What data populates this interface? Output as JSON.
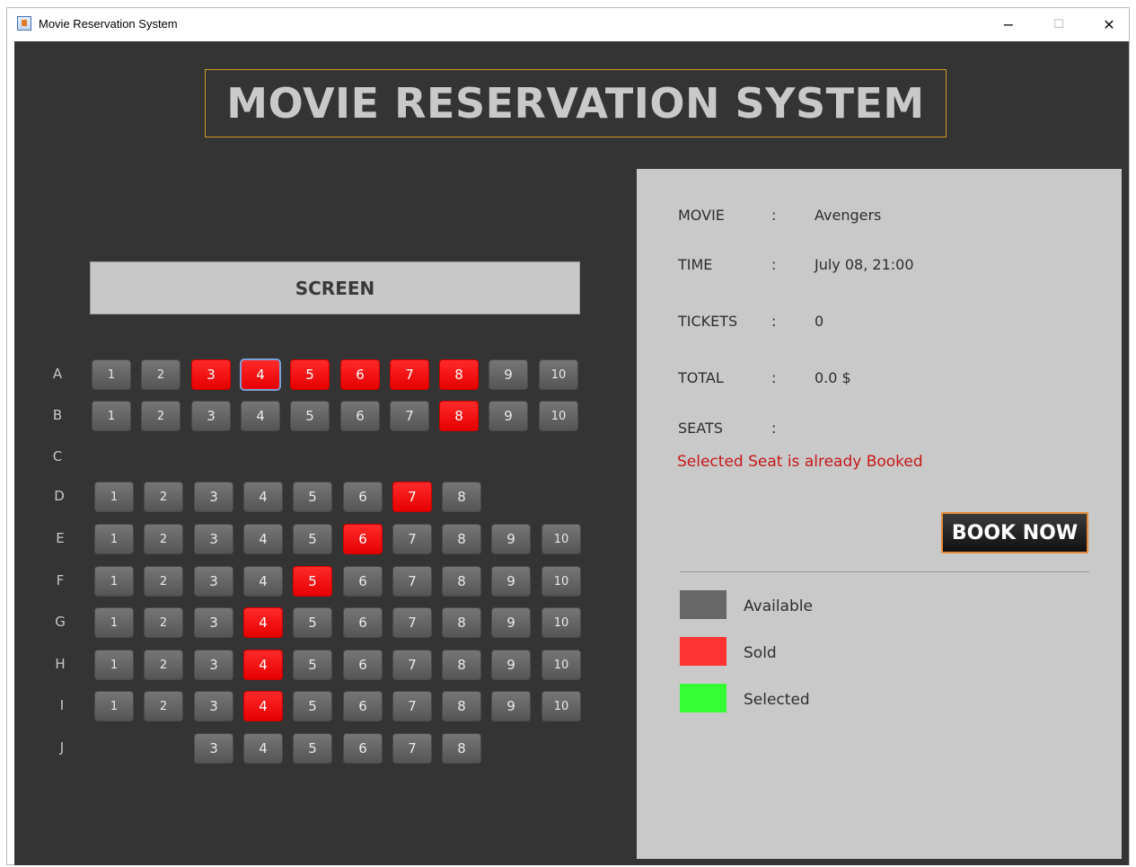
{
  "window": {
    "title": "Movie Reservation System",
    "min_symbol": "−",
    "max_symbol": "☐",
    "close_symbol": "✕"
  },
  "header": {
    "title": "MOVIE RESERVATION SYSTEM"
  },
  "screen_label": "SCREEN",
  "rows": {
    "A": {
      "seats": [
        "1",
        "2",
        "3",
        "4",
        "5",
        "6",
        "7",
        "8",
        "9",
        "10"
      ],
      "sold": [
        "3",
        "4",
        "5",
        "6",
        "7",
        "8"
      ]
    },
    "B": {
      "seats": [
        "1",
        "2",
        "3",
        "4",
        "5",
        "6",
        "7",
        "8",
        "9",
        "10"
      ],
      "sold": [
        "8"
      ]
    },
    "C": {
      "seats": [],
      "sold": []
    },
    "D": {
      "seats": [
        "1",
        "2",
        "3",
        "4",
        "5",
        "6",
        "7",
        "8"
      ],
      "sold": [
        "7"
      ]
    },
    "E": {
      "seats": [
        "1",
        "2",
        "3",
        "4",
        "5",
        "6",
        "7",
        "8",
        "9",
        "10"
      ],
      "sold": [
        "6"
      ]
    },
    "F": {
      "seats": [
        "1",
        "2",
        "3",
        "4",
        "5",
        "6",
        "7",
        "8",
        "9",
        "10"
      ],
      "sold": [
        "5"
      ]
    },
    "G": {
      "seats": [
        "1",
        "2",
        "3",
        "4",
        "5",
        "6",
        "7",
        "8",
        "9",
        "10"
      ],
      "sold": [
        "4"
      ]
    },
    "H": {
      "seats": [
        "1",
        "2",
        "3",
        "4",
        "5",
        "6",
        "7",
        "8",
        "9",
        "10"
      ],
      "sold": [
        "4"
      ]
    },
    "I": {
      "seats": [
        "1",
        "2",
        "3",
        "4",
        "5",
        "6",
        "7",
        "8",
        "9",
        "10"
      ],
      "sold": [
        "4"
      ]
    },
    "J": {
      "seats": [
        "3",
        "4",
        "5",
        "6",
        "7",
        "8"
      ],
      "sold": []
    }
  },
  "row_labels": [
    "A",
    "B",
    "C",
    "D",
    "E",
    "F",
    "G",
    "H",
    "I",
    "J"
  ],
  "focused_seat": "A4",
  "info": {
    "colon": ":",
    "movie_label": "MOVIE",
    "movie_value": "Avengers",
    "time_label": "TIME",
    "time_value": "July 08, 21:00",
    "tickets_label": "TICKETS",
    "tickets_value": "0",
    "total_label": "TOTAL",
    "total_value": "0.0 $",
    "seats_label": "SEATS",
    "seats_value": ""
  },
  "message": "Selected Seat is already Booked",
  "book_button": "BOOK NOW",
  "legend": {
    "available": {
      "label": "Available",
      "color": "#676767"
    },
    "sold": {
      "label": "Sold",
      "color": "#ff3333"
    },
    "selected": {
      "label": "Selected",
      "color": "#33ff33"
    }
  },
  "colors": {
    "background": "#343434",
    "panel": "#c9c9c9",
    "header_border": "#d49a2c",
    "sold_seat": "#ff1f1f",
    "message": "#c81818"
  }
}
